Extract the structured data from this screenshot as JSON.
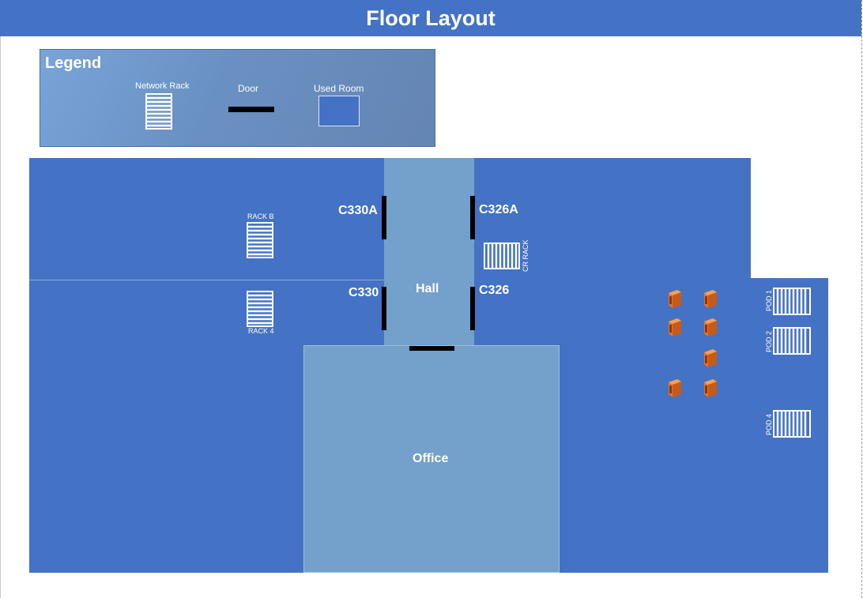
{
  "title": "Floor Layout",
  "legend": {
    "title": "Legend",
    "network_rack": "Network Rack",
    "door": "Door",
    "used_room": "Used Room"
  },
  "rooms": {
    "c330a": "C330A",
    "c326a": "C326A",
    "c330": "C330",
    "c326": "C326",
    "hall": "Hall",
    "office": "Office"
  },
  "racks": {
    "rack_b": "RACK B",
    "rack_4": "RACK 4",
    "cr_rack": "CR RACK",
    "pod_1": "POD 1",
    "pod_2": "POD 2",
    "pod_4": "POD 4"
  },
  "colors": {
    "used_room": "#4472c4",
    "hall": "#74a0cc",
    "door": "#000000",
    "server": "#e8722a"
  },
  "icons": {
    "rack": "rack-icon",
    "server": "server-icon"
  }
}
